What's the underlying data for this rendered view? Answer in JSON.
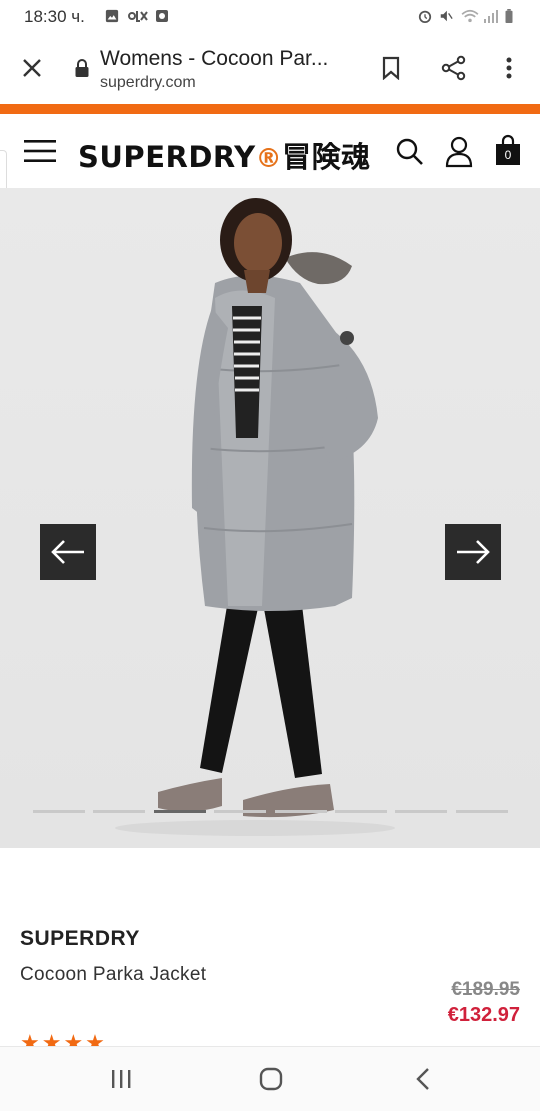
{
  "status_bar": {
    "time": "18:30 ч."
  },
  "browser": {
    "page_title": "Womens - Cocoon Par...",
    "url": "superdry.com"
  },
  "site_header": {
    "logo_text": "SUPERDRY",
    "logo_mark": "®",
    "logo_cjk": "冒険魂",
    "cart_count": "0"
  },
  "gallery": {
    "image_description_icon": "product-photo",
    "slide_count": 8,
    "active_slide": 3
  },
  "product": {
    "brand": "SUPERDRY",
    "name": "Cocoon Parka Jacket",
    "old_price": "€189.95",
    "new_price": "€132.97",
    "rating_stars": "★★★★"
  },
  "colors": {
    "accent_orange": "#f16a13",
    "sale_red": "#d0213b"
  }
}
